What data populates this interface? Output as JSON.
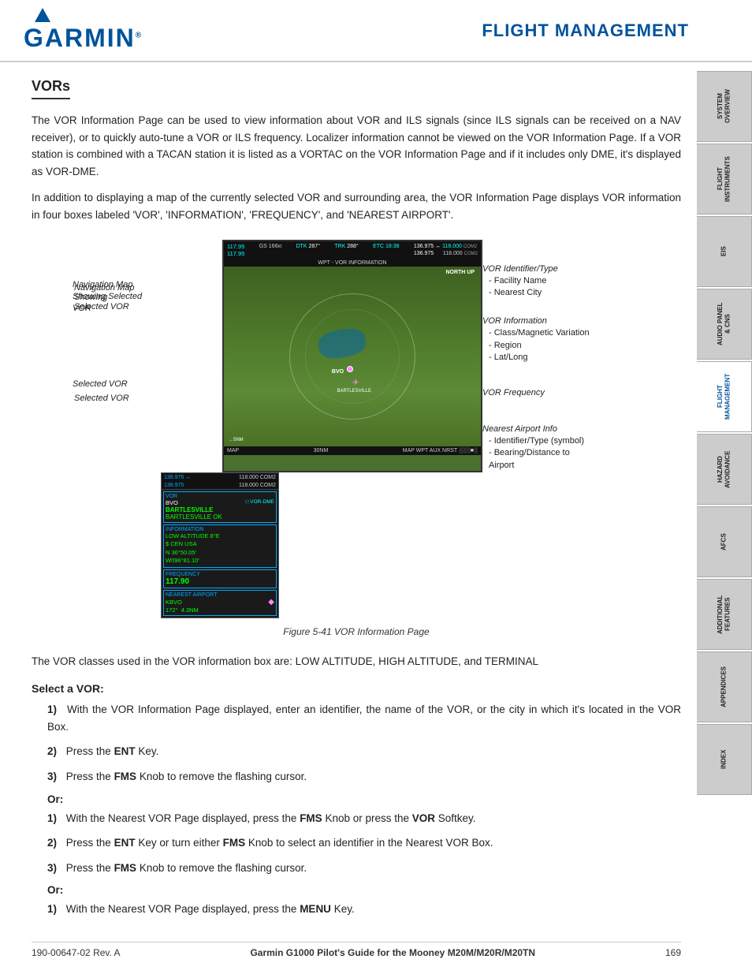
{
  "header": {
    "logo_text": "GARMIN",
    "title": "FLIGHT MANAGEMENT"
  },
  "sidebar": {
    "tabs": [
      {
        "id": "system-overview",
        "label": "SYSTEM\nOVERVIEW"
      },
      {
        "id": "flight-instruments",
        "label": "FLIGHT\nINSTRUMENTS"
      },
      {
        "id": "eis",
        "label": "EIS"
      },
      {
        "id": "audio-panel",
        "label": "AUDIO PANEL\n& CNS"
      },
      {
        "id": "flight-management",
        "label": "FLIGHT\nMANAGEMENT",
        "active": true
      },
      {
        "id": "hazard-avoidance",
        "label": "HAZARD\nAVOIDANCE"
      },
      {
        "id": "afcs",
        "label": "AFCS"
      },
      {
        "id": "additional-features",
        "label": "ADDITIONAL\nFEATURES"
      },
      {
        "id": "appendices",
        "label": "APPENDICES"
      },
      {
        "id": "index",
        "label": "INDEX"
      }
    ]
  },
  "section": {
    "title": "VORs",
    "intro_para1": "The VOR Information Page can be used to view information about VOR and ILS signals (since ILS signals can be received on a NAV receiver), or to quickly auto-tune a VOR or ILS frequency.  Localizer information cannot be viewed on the VOR Information Page.  If a VOR station is combined with a TACAN station it is listed as a VORTAC on the VOR Information Page and if it includes only DME, it's displayed as VOR-DME.",
    "intro_para2": "In addition to displaying a map of the currently selected VOR and surrounding area, the VOR Information Page displays VOR information in four boxes labeled 'VOR', 'INFORMATION', 'FREQUENCY', and 'NEAREST AIRPORT'."
  },
  "figure": {
    "caption": "Figure 5-41  VOR Information Page",
    "map": {
      "header_left": "117.95\n117.95",
      "header_gs": "GS 166kt",
      "header_dtk": "DTK 287°",
      "header_trk": "TRK 288°",
      "header_etc": "ETC 18:38",
      "header_freq1": "136.975 ↔",
      "header_freq2": "118.000 COM2",
      "header_freq3": "136.975",
      "header_freq4": "118.000 COM2",
      "waypoint_label": "WPT - VOR INFORMATION",
      "north_up": "NORTH UP",
      "vor_box_label": "VOR",
      "vor_id": "BVO",
      "vor_type": "VOR-DME",
      "vor_name": "BARTLESVILLE",
      "vor_city": "BARTLESVILLE OK",
      "info_box_label": "INFORMATION",
      "info_altitude": "LOW ALTITUDE  8°E",
      "info_region": "$ CEN USA",
      "info_lat": "N 36°50.05'",
      "info_lon": "W096°81.10'",
      "freq_box_label": "FREQUENCY",
      "freq_value": "117.90",
      "nearest_box_label": "NEAREST AIRPORT",
      "nearest_id": "KBVO",
      "nearest_bearing": "172°",
      "nearest_distance": "4.3NM",
      "map_scale": "30NM",
      "map_bottom": "MAP WPT AUX NRST"
    },
    "callouts": {
      "nav_map": "Navigation Map\nShowing\nSelected VOR",
      "selected_vor": "Selected VOR"
    },
    "annotations": {
      "vor_id_type": "VOR Identifier/Type",
      "vor_id_sub1": "- Facility Name",
      "vor_id_sub2": "- Nearest City",
      "vor_info": "VOR Information",
      "vor_info_sub1": "- Class/Magnetic Variation",
      "vor_info_sub2": "- Region",
      "vor_info_sub3": "- Lat/Long",
      "vor_freq": "VOR Frequency",
      "nearest_airport": "Nearest Airport Info",
      "nearest_sub1": "- Identifier/Type (symbol)",
      "nearest_sub2": "- Bearing/Distance to",
      "nearest_sub3": "  Airport"
    }
  },
  "body": {
    "vor_classes_text": "The VOR classes used in the VOR information box are:  LOW ALTITUDE, HIGH ALTITUDE, and TERMINAL",
    "select_vor_title": "Select a VOR:",
    "steps_group1": [
      {
        "num": "1)",
        "text": "With the VOR Information Page displayed, enter an identifier, the name of the VOR, or the city in which it's located in the VOR Box."
      },
      {
        "num": "2)",
        "text_before": "Press the ",
        "bold": "ENT",
        "text_after": " Key."
      },
      {
        "num": "3)",
        "text_before": "Press the ",
        "bold": "FMS",
        "text_after": " Knob to remove the flashing cursor."
      }
    ],
    "or1": "Or:",
    "steps_group2": [
      {
        "num": "1)",
        "text_before": "With the Nearest VOR Page displayed, press the ",
        "bold1": "FMS",
        "text_mid": " Knob or press the ",
        "bold2": "VOR",
        "text_after": " Softkey."
      },
      {
        "num": "2)",
        "text_before": "Press the ",
        "bold1": "ENT",
        "text_mid": " Key or turn either ",
        "bold2": "FMS",
        "text_after": " Knob to select an identifier in the Nearest VOR Box."
      },
      {
        "num": "3)",
        "text_before": "Press the ",
        "bold": "FMS",
        "text_after": " Knob to remove the flashing cursor."
      }
    ],
    "or2": "Or:",
    "steps_group3": [
      {
        "num": "1)",
        "text_before": "With the Nearest VOR Page displayed, press the ",
        "bold": "MENU",
        "text_after": " Key."
      }
    ]
  },
  "footer": {
    "left": "190-00647-02  Rev. A",
    "center": "Garmin G1000 Pilot's Guide for the Mooney M20M/M20R/M20TN",
    "right": "169"
  }
}
